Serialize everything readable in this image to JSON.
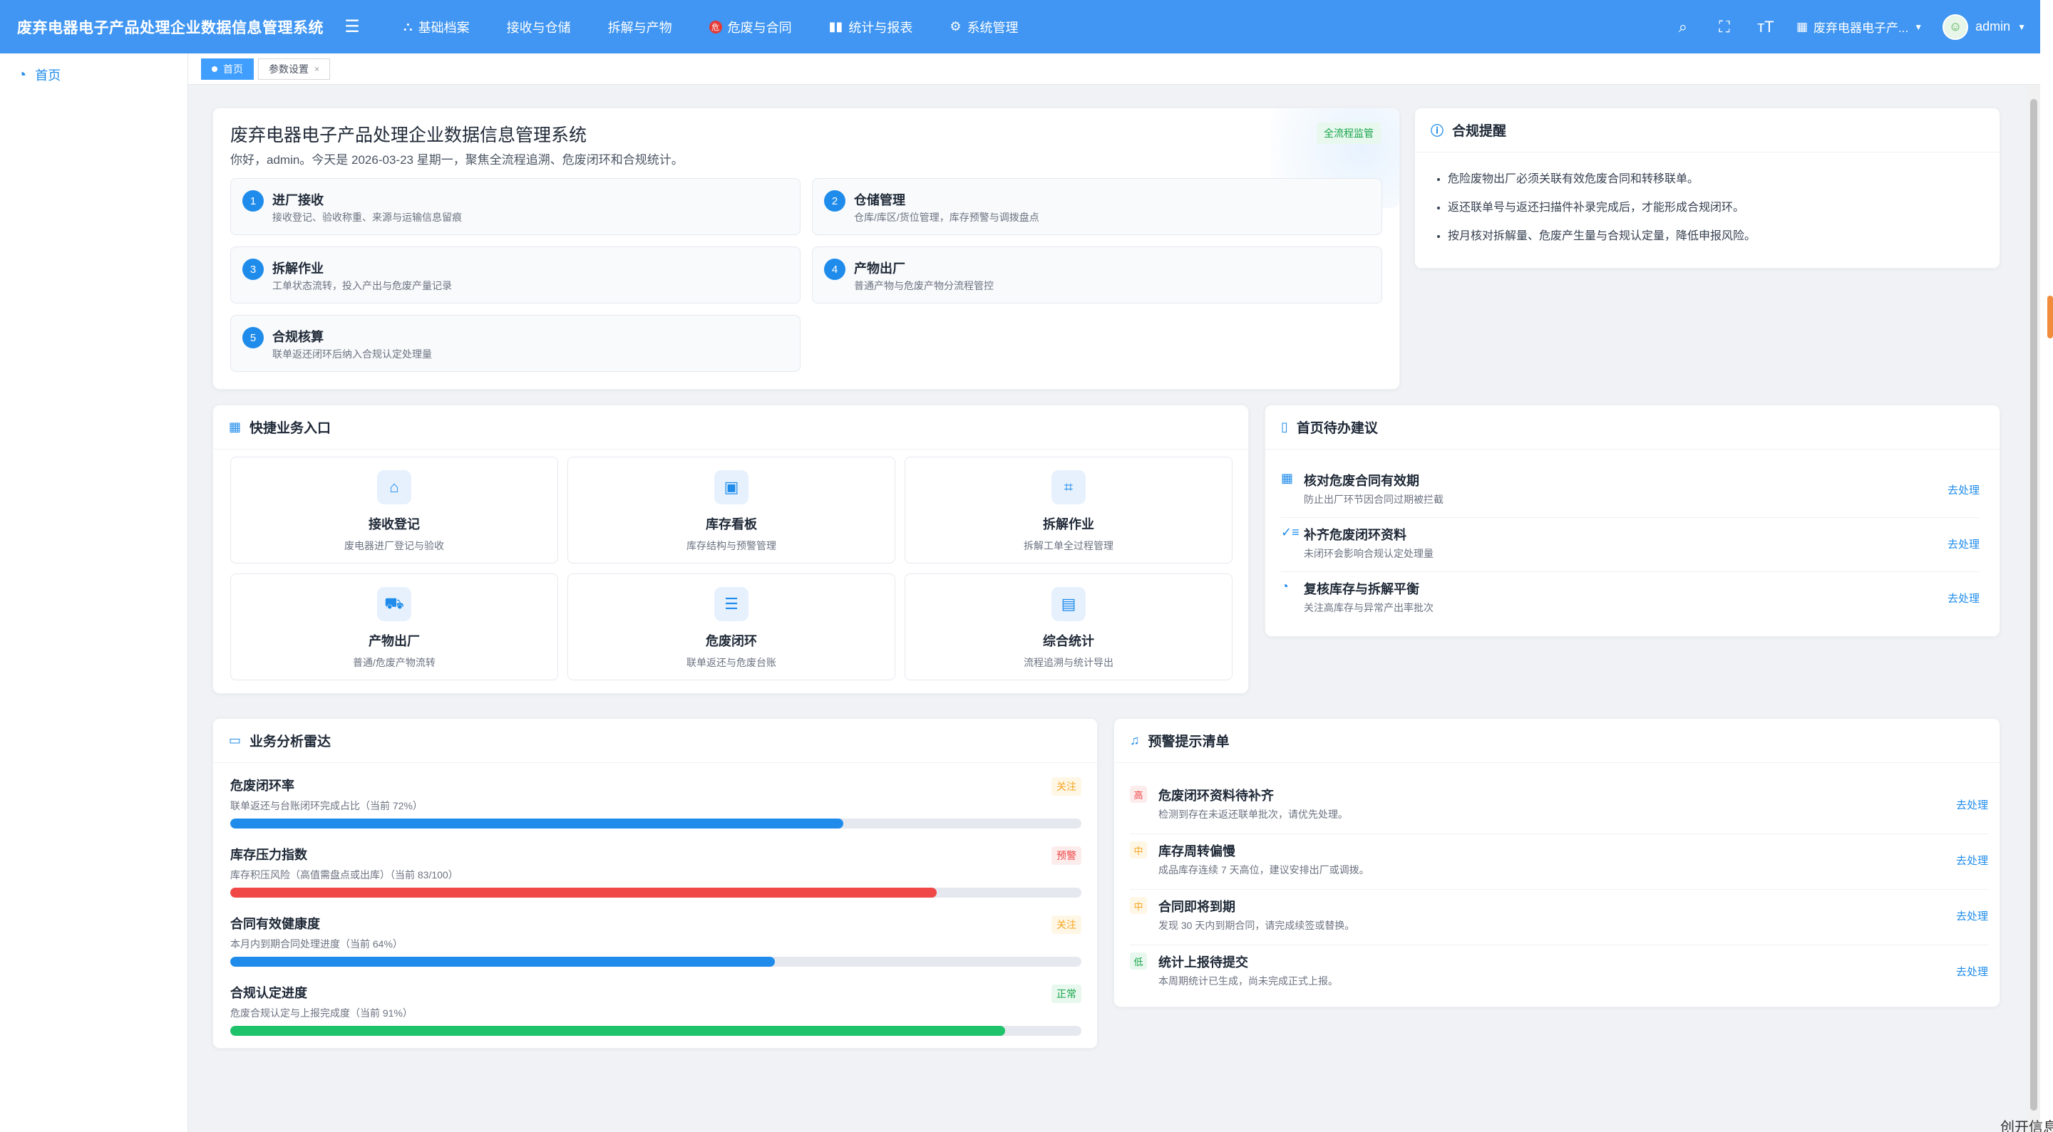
{
  "app": {
    "title": "废弃电器电子产品处理企业数据信息管理系统"
  },
  "nav": [
    {
      "label": "基础档案",
      "icon": "sitemap-icon"
    },
    {
      "label": "接收与仓储",
      "icon": ""
    },
    {
      "label": "拆解与产物",
      "icon": ""
    },
    {
      "label": "危废与合同",
      "icon": "hazard-icon"
    },
    {
      "label": "统计与报表",
      "icon": "bar-chart-icon"
    },
    {
      "label": "系统管理",
      "icon": "gear-icon"
    }
  ],
  "header": {
    "tenant": "废弃电器电子产...",
    "user": "admin"
  },
  "sidebar": {
    "items": [
      {
        "label": "首页",
        "icon": "dashboard-icon"
      }
    ]
  },
  "tags": [
    {
      "label": "首页",
      "active": true
    },
    {
      "label": "参数设置",
      "active": false
    }
  ],
  "hero": {
    "title": "废弃电器电子产品处理企业数据信息管理系统",
    "subtitle": "你好，admin。今天是 2026-03-23 星期一，聚焦全流程追溯、危废闭环和合规统计。",
    "badge": "全流程监管",
    "steps": [
      {
        "num": "1",
        "title": "进厂接收",
        "desc": "接收登记、验收称重、来源与运输信息留痕"
      },
      {
        "num": "2",
        "title": "仓储管理",
        "desc": "仓库/库区/货位管理，库存预警与调拨盘点"
      },
      {
        "num": "3",
        "title": "拆解作业",
        "desc": "工单状态流转，投入产出与危废产量记录"
      },
      {
        "num": "4",
        "title": "产物出厂",
        "desc": "普通产物与危废产物分流程管控"
      },
      {
        "num": "5",
        "title": "合规核算",
        "desc": "联单返还闭环后纳入合规认定处理量"
      }
    ]
  },
  "compliance": {
    "title": "合规提醒",
    "items": [
      "危险废物出厂必须关联有效危废合同和转移联单。",
      "返还联单号与返还扫描件补录完成后，才能形成合规闭环。",
      "按月核对拆解量、危废产生量与合规认定量，降低申报风险。"
    ]
  },
  "quick": {
    "title": "快捷业务入口",
    "tiles": [
      {
        "title": "接收登记",
        "desc": "废电器进厂登记与验收",
        "icon": "inbox-icon"
      },
      {
        "title": "库存看板",
        "desc": "库存结构与预警管理",
        "icon": "box-icon"
      },
      {
        "title": "拆解作业",
        "desc": "拆解工单全过程管理",
        "icon": "chip-icon"
      },
      {
        "title": "产物出厂",
        "desc": "普通/危废产物流转",
        "icon": "truck-icon"
      },
      {
        "title": "危废闭环",
        "desc": "联单返还与危废台账",
        "icon": "document-icon"
      },
      {
        "title": "综合统计",
        "desc": "流程追溯与统计导出",
        "icon": "report-icon"
      }
    ]
  },
  "todo": {
    "title": "首页待办建议",
    "items": [
      {
        "title": "核对危废合同有效期",
        "desc": "防止出厂环节因合同过期被拦截",
        "action": "去处理",
        "icon": "calendar-icon"
      },
      {
        "title": "补齐危废闭环资料",
        "desc": "未闭环会影响合规认定处理量",
        "action": "去处理",
        "icon": "checklist-icon"
      },
      {
        "title": "复核库存与拆解平衡",
        "desc": "关注高库存与异常产出率批次",
        "action": "去处理",
        "icon": "pie-icon"
      }
    ]
  },
  "radar": {
    "title": "业务分析雷达",
    "metrics": [
      {
        "title": "危废闭环率",
        "desc": "联单返还与台账闭环完成占比（当前 72%）",
        "badge": "关注",
        "value": 72,
        "color": "#1f8ceb",
        "badge_color": "warn"
      },
      {
        "title": "库存压力指数",
        "desc": "库存积压风险（高值需盘点或出库）（当前 83/100）",
        "badge": "预警",
        "value": 83,
        "color": "#f04747",
        "badge_color": "red"
      },
      {
        "title": "合同有效健康度",
        "desc": "本月内到期合同处理进度（当前 64%）",
        "badge": "关注",
        "value": 64,
        "color": "#1f8ceb",
        "badge_color": "warn"
      },
      {
        "title": "合规认定进度",
        "desc": "危废合规认定与上报完成度（当前 91%）",
        "badge": "正常",
        "value": 91,
        "color": "#1ec26a",
        "badge_color": "green"
      }
    ]
  },
  "alerts": {
    "title": "预警提示清单",
    "items": [
      {
        "level": "高",
        "title": "危废闭环资料待补齐",
        "desc": "检测到存在未返还联单批次，请优先处理。",
        "action": "去处理",
        "level_color": "red"
      },
      {
        "level": "中",
        "title": "库存周转偏慢",
        "desc": "成品库存连续 7 天高位，建议安排出厂或调拨。",
        "action": "去处理",
        "level_color": "warn"
      },
      {
        "level": "中",
        "title": "合同即将到期",
        "desc": "发现 30 天内到期合同，请完成续签或替换。",
        "action": "去处理",
        "level_color": "warn"
      },
      {
        "level": "低",
        "title": "统计上报待提交",
        "desc": "本周期统计已生成，尚未完成正式上报。",
        "action": "去处理",
        "level_color": "green"
      }
    ]
  },
  "watermark": "创开信息"
}
